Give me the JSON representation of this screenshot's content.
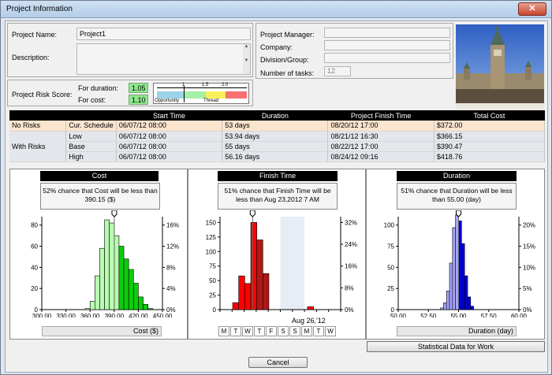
{
  "window": {
    "title": "Project Information",
    "close": "✕"
  },
  "info": {
    "project_name_label": "Project Name:",
    "project_name": "Project1",
    "description_label": "Description:",
    "manager_label": "Project Manager:",
    "company_label": "Company:",
    "division_label": "Division/Group:",
    "tasks_label": "Number of tasks:",
    "tasks": "12"
  },
  "risk": {
    "label": "Project Risk Score:",
    "duration_label": "For duration:",
    "duration": "1.05",
    "cost_label": "For cost:",
    "cost": "1.10",
    "scale_ticks": [
      "1",
      "1.5",
      "2.0"
    ],
    "scale_left": "Opportunity",
    "scale_right": "Thread"
  },
  "table": {
    "headers": [
      "",
      "",
      "Start Time",
      "Duration",
      "Project Finish Time",
      "Total Cost"
    ],
    "rows": [
      {
        "group": "No Risks",
        "type": "Cur. Schedule",
        "start": "06/07/12 08:00",
        "duration": "53 days",
        "finish": "08/20/12 17:00",
        "cost": "$372.00"
      },
      {
        "group": "With Risks",
        "type": "Low",
        "start": "06/07/12 08:00",
        "duration": "53.94 days",
        "finish": "08/21/12 16:30",
        "cost": "$366.15"
      },
      {
        "group": "",
        "type": "Base",
        "start": "06/07/12 08:00",
        "duration": "55 days",
        "finish": "08/22/12 17:00",
        "cost": "$390.47"
      },
      {
        "group": "",
        "type": "High",
        "start": "06/07/12 08:00",
        "duration": "56.16 days",
        "finish": "08/24/12 09:16",
        "cost": "$418.76"
      }
    ]
  },
  "chart_data": [
    {
      "type": "bar",
      "title": "Cost",
      "note": "52% chance that Cost will be less than 390.15 ($)",
      "xlabel": "Cost ($)",
      "x_ticks": [
        "300.00",
        "330.00",
        "360.00",
        "390.00",
        "420.00",
        "450.00"
      ],
      "y_ticks": [
        "0",
        "20",
        "40",
        "60",
        "80"
      ],
      "y2_ticks": [
        "0%",
        "4%",
        "8%",
        "12%",
        "16%"
      ],
      "xlim": [
        300,
        450
      ],
      "ylim": [
        0,
        88
      ],
      "bin_start": 354,
      "bin_width": 6,
      "values": [
        1,
        8,
        32,
        58,
        85,
        82,
        70,
        60,
        48,
        38,
        25,
        12,
        5,
        1
      ],
      "marker": 390.15
    },
    {
      "type": "bar",
      "title": "Finish Time",
      "note": "51% chance that Finish Time will be less than Aug 23,2012 7 AM",
      "xlabel": "",
      "axis_date": "Aug 26,'12",
      "days": [
        "M",
        "T",
        "W",
        "T",
        "F",
        "S",
        "S",
        "M",
        "T",
        "W"
      ],
      "y_ticks": [
        "0",
        "25",
        "50",
        "75",
        "100",
        "125",
        "150"
      ],
      "y2_ticks": [
        "0%",
        "8%",
        "16%",
        "24%",
        "32%"
      ],
      "ylim": [
        0,
        160
      ],
      "x": [
        1.3,
        1.8,
        2.3,
        2.8,
        3.3,
        3.8,
        7.5
      ],
      "values": [
        12,
        58,
        45,
        150,
        120,
        62,
        5
      ],
      "dark": [
        false,
        false,
        false,
        false,
        true,
        true,
        false
      ],
      "marker": 2.7
    },
    {
      "type": "bar",
      "title": "Duration",
      "note": "51% chance that Duration will be less than 55.00 (day)",
      "xlabel": "Duration (day)",
      "x_ticks": [
        "50.00",
        "52.50",
        "55.00",
        "57.50",
        "60.00"
      ],
      "y_ticks": [
        "0",
        "25",
        "50",
        "75",
        "100"
      ],
      "y2_ticks": [
        "0%",
        "5%",
        "10%",
        "15%",
        "20%"
      ],
      "xlim": [
        50,
        60
      ],
      "ylim": [
        0,
        110
      ],
      "bin_start": 53.5,
      "bin_width": 0.25,
      "values": [
        2,
        8,
        22,
        55,
        97,
        112,
        105,
        78,
        40,
        15,
        4
      ],
      "split": 55,
      "marker": 55
    }
  ],
  "stats_label": "Statistical Data for Work",
  "cancel": "Cancel",
  "colors": {
    "cost_light": "#b8fcb0",
    "cost_dark": "#0ccd0c",
    "finish_light": "#ff0000",
    "finish_dark": "#b01818",
    "dur_light": "#a4a4fc",
    "dur_dark": "#0000d8"
  }
}
